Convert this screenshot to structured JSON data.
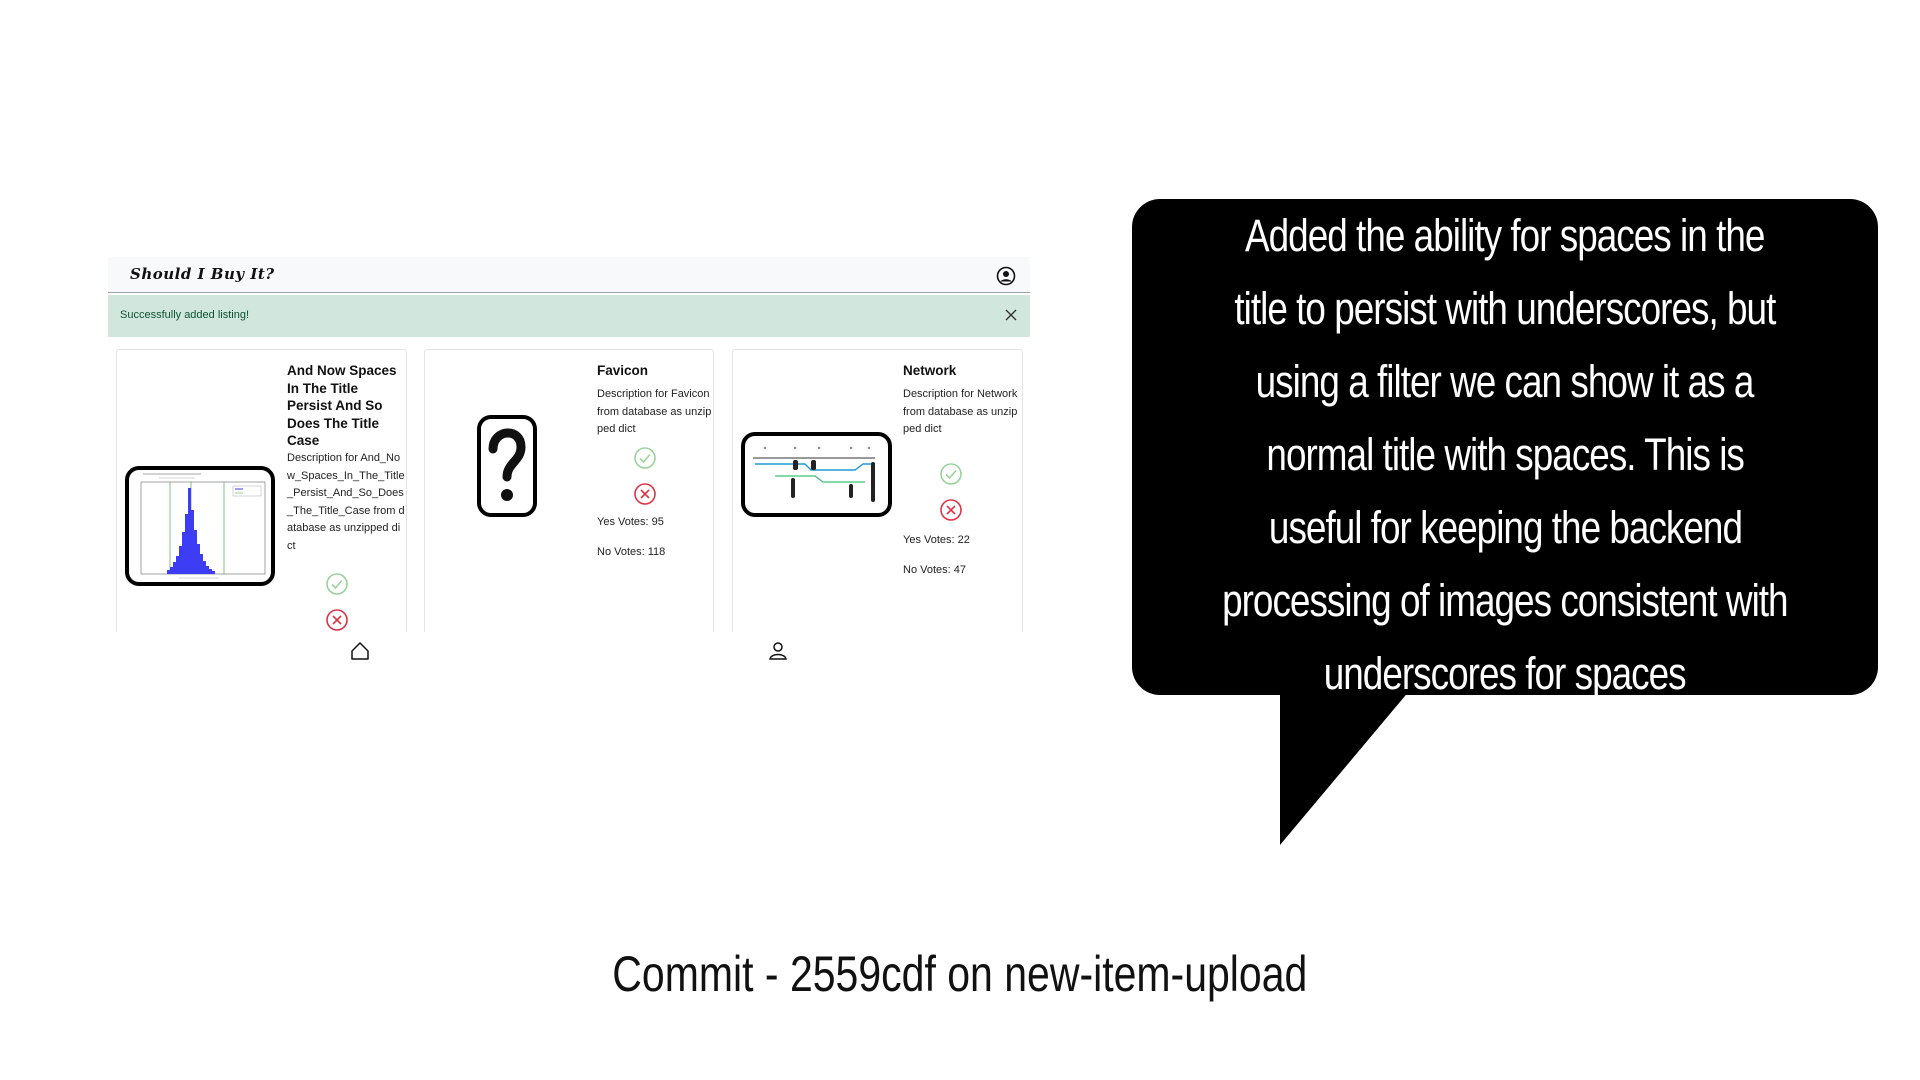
{
  "app": {
    "brand": "Should I Buy It?",
    "alert": "Successfully added listing!",
    "cards": [
      {
        "title": "And Now Spaces In The Title Persist And So Does The Title Case",
        "description": "Description for And_Now_Spaces_In_The_Title_Persist_And_So_Does_The_Title_Case from database as unzipped dict",
        "image": "histogram-chart-image"
      },
      {
        "title": "Favicon",
        "description": "Description for Favicon from database as unzipped dict",
        "yes_votes": "Yes Votes: 95",
        "no_votes": "No Votes: 118",
        "image": "question-mark-image"
      },
      {
        "title": "Network",
        "description": "Description for Network from database as unzipped dict",
        "yes_votes": "Yes Votes: 22",
        "no_votes": "No Votes: 47",
        "image": "network-diagram-image"
      }
    ],
    "icons": {
      "profile": "user-circle-icon",
      "close": "close-icon",
      "yes": "check-circle-icon",
      "no": "x-circle-icon",
      "home": "home-icon",
      "person": "person-icon"
    },
    "colors": {
      "alert_bg": "#d1e7dd",
      "alert_text": "#0f5132",
      "yes": "#5cb85c",
      "no": "#dc3545",
      "histogram": "#3d3df5"
    }
  },
  "bubble": {
    "lines": [
      "Added the ability for spaces in the",
      "title to persist with underscores, but",
      "using a filter we can show it as a",
      "normal title with spaces. This is",
      "useful for keeping the backend",
      "processing of images consistent with",
      "underscores for spaces"
    ]
  },
  "caption": "Commit - 2559cdf on new-item-upload"
}
